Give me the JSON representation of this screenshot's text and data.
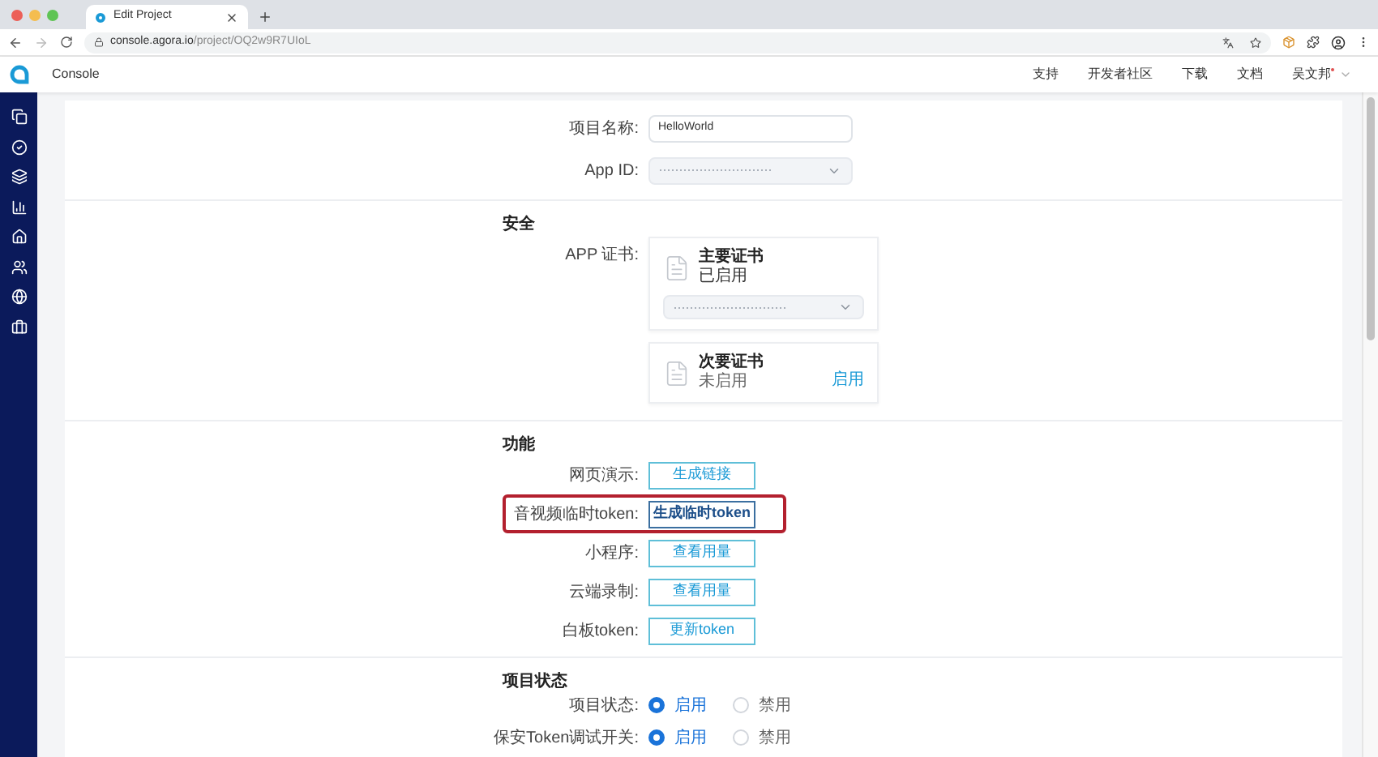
{
  "browser": {
    "tab_title": "Edit Project",
    "url_host": "console.agora.io",
    "url_path": "/project/OQ2w9R7UIoL"
  },
  "header": {
    "brand": "Console",
    "nav": [
      "支持",
      "开发者社区",
      "下载",
      "文档"
    ],
    "user": "吴文邦"
  },
  "basic": {
    "fields": [
      {
        "kind": "input",
        "label": "项目名称:",
        "value": "HelloWorld"
      },
      {
        "kind": "masked",
        "label": "App ID:"
      }
    ]
  },
  "security": {
    "title": "安全",
    "label": "APP 证书:",
    "certificates": [
      {
        "title": "主要证书",
        "status": "已启用",
        "enabled": true
      },
      {
        "title": "次要证书",
        "status": "未启用",
        "enabled": false,
        "action": "启用"
      }
    ]
  },
  "features": {
    "title": "功能",
    "rows": [
      {
        "label": "网页演示:",
        "button": "生成链接",
        "highlighted": false
      },
      {
        "label": "音视频临时token:",
        "button": "生成临时token",
        "highlighted": true
      },
      {
        "label": "小程序:",
        "button": "查看用量",
        "highlighted": false
      },
      {
        "label": "云端录制:",
        "button": "查看用量",
        "highlighted": false
      },
      {
        "label": "白板token:",
        "button": "更新token",
        "highlighted": false
      }
    ]
  },
  "status": {
    "title": "项目状态",
    "rows": [
      {
        "label": "项目状态:",
        "options": [
          {
            "label": "启用",
            "selected": true
          },
          {
            "label": "禁用",
            "selected": false
          }
        ]
      },
      {
        "label": "保安Token调试开关:",
        "options": [
          {
            "label": "启用",
            "selected": true
          },
          {
            "label": "禁用",
            "selected": false
          }
        ]
      }
    ]
  }
}
